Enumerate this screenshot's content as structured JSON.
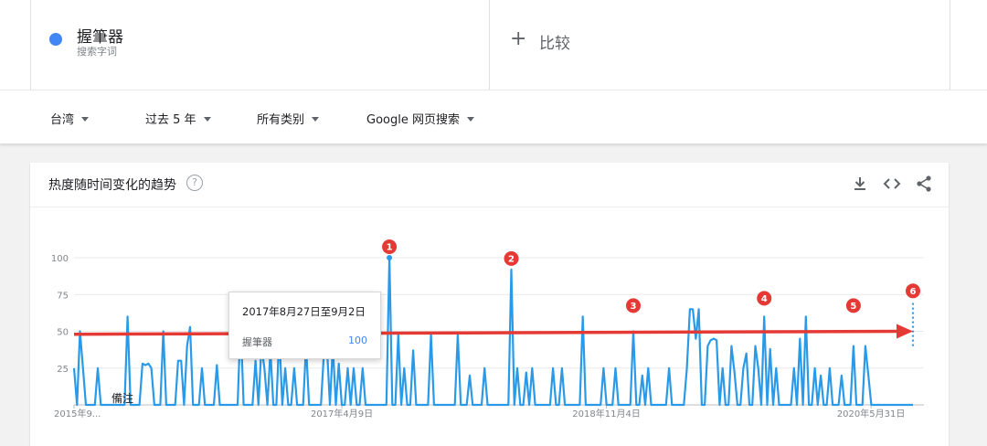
{
  "terms": [
    {
      "name": "握筆器",
      "subtitle": "搜索字词",
      "color": "#4285f4"
    }
  ],
  "compare": {
    "label": "比较"
  },
  "filters": [
    {
      "label": "台湾"
    },
    {
      "label": "过去 5 年"
    },
    {
      "label": "所有类别"
    },
    {
      "label": "Google 网页搜索"
    }
  ],
  "card": {
    "title": "热度随时间变化的趋势"
  },
  "tooltip": {
    "date": "2017年8月27日至9月2日",
    "term": "握筆器",
    "value": "100"
  },
  "note_label": "備注",
  "chart_data": {
    "type": "line",
    "series": [
      {
        "name": "握筆器",
        "color": "#4285f4"
      }
    ],
    "line_color": "#2a9ae8",
    "ylim": [
      0,
      100
    ],
    "yticks": [
      25,
      50,
      75,
      100
    ],
    "xtick_labels": [
      "2015年9...",
      "2017年4月9日",
      "2018年11月4日",
      "2020年5月31日"
    ],
    "x_start": "2015-09-06",
    "x_end": "2020-08-30",
    "grid": true,
    "values": [
      25,
      0,
      50,
      25,
      0,
      0,
      0,
      0,
      25,
      0,
      0,
      0,
      0,
      0,
      0,
      0,
      0,
      0,
      60,
      0,
      0,
      0,
      0,
      28,
      27,
      28,
      25,
      0,
      0,
      0,
      50,
      0,
      0,
      0,
      0,
      30,
      30,
      0,
      40,
      53,
      0,
      0,
      0,
      25,
      0,
      0,
      0,
      0,
      27,
      0,
      0,
      0,
      0,
      0,
      0,
      0,
      57,
      0,
      0,
      0,
      0,
      30,
      0,
      40,
      25,
      0,
      37,
      0,
      0,
      48,
      0,
      25,
      0,
      0,
      25,
      0,
      0,
      0,
      40,
      0,
      0,
      0,
      0,
      0,
      35,
      40,
      0,
      40,
      0,
      28,
      0,
      0,
      25,
      0,
      25,
      0,
      0,
      25,
      0,
      0,
      0,
      0,
      0,
      0,
      0,
      0,
      100,
      0,
      0,
      48,
      0,
      25,
      0,
      0,
      37,
      0,
      0,
      0,
      0,
      0,
      48,
      0,
      0,
      0,
      0,
      0,
      0,
      0,
      0,
      48,
      0,
      0,
      0,
      20,
      0,
      0,
      0,
      0,
      25,
      0,
      0,
      0,
      0,
      0,
      0,
      0,
      0,
      92,
      0,
      25,
      0,
      0,
      22,
      0,
      25,
      0,
      0,
      0,
      0,
      0,
      0,
      25,
      0,
      0,
      25,
      0,
      0,
      0,
      0,
      0,
      0,
      60,
      0,
      0,
      0,
      0,
      0,
      0,
      25,
      0,
      0,
      0,
      25,
      0,
      0,
      0,
      0,
      0,
      50,
      0,
      0,
      20,
      0,
      25,
      0,
      0,
      0,
      0,
      0,
      0,
      25,
      0,
      0,
      0,
      0,
      0,
      25,
      65,
      65,
      45,
      65,
      0,
      0,
      40,
      44,
      45,
      44,
      0,
      25,
      0,
      0,
      40,
      22,
      0,
      0,
      25,
      35,
      0,
      0,
      40,
      25,
      0,
      60,
      0,
      38,
      0,
      25,
      0,
      0,
      0,
      0,
      0,
      25,
      0,
      45,
      0,
      60,
      0,
      0,
      25,
      0,
      20,
      0,
      0,
      25,
      0,
      0,
      0,
      20,
      0,
      0,
      0,
      40,
      0,
      0,
      0,
      40,
      20,
      0,
      0,
      0,
      0,
      0,
      0,
      0,
      0,
      0,
      0,
      0,
      0,
      0,
      0,
      0
    ],
    "dotted_segment": [
      40,
      70
    ],
    "annotations": [
      {
        "label": "1",
        "value": 100
      },
      {
        "label": "2",
        "value": 92
      },
      {
        "label": "3",
        "value": 60
      },
      {
        "label": "4",
        "value": 65
      },
      {
        "label": "5",
        "value": 60
      },
      {
        "label": "6",
        "value": 70
      }
    ],
    "overlay_arrow": {
      "color": "#e53935",
      "value_start": 48,
      "value_end": 50
    }
  }
}
